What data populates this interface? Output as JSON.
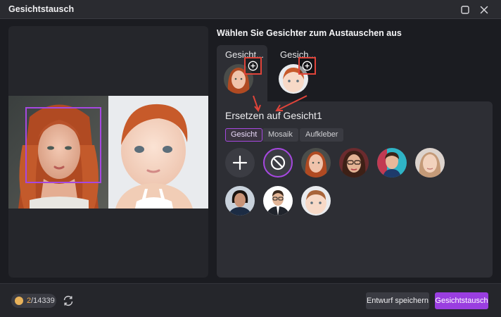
{
  "window": {
    "title": "Gesichtstausch",
    "maximize_icon": "maximize-icon",
    "close_icon": "close-icon"
  },
  "heading": "Wählen Sie Gesichter zum Austauschen aus",
  "face_tabs": [
    {
      "label": "Gesicht...",
      "active": true
    },
    {
      "label": "Gesich...",
      "active": false
    }
  ],
  "replace_panel": {
    "title": "Ersetzen auf Gesicht1",
    "tabs": [
      "Gesicht",
      "Mosaik",
      "Aufkleber"
    ],
    "active_tab": "Gesicht"
  },
  "footer": {
    "credits_used": "2",
    "credits_total": "/14339",
    "draft_button": "Entwurf speichern",
    "swap_button": "Gesichtstausch"
  },
  "colors": {
    "accent": "#a648e0",
    "primary_button": "#9a3ee0",
    "highlight_border": "#e0443a",
    "background": "#1b1c21"
  }
}
